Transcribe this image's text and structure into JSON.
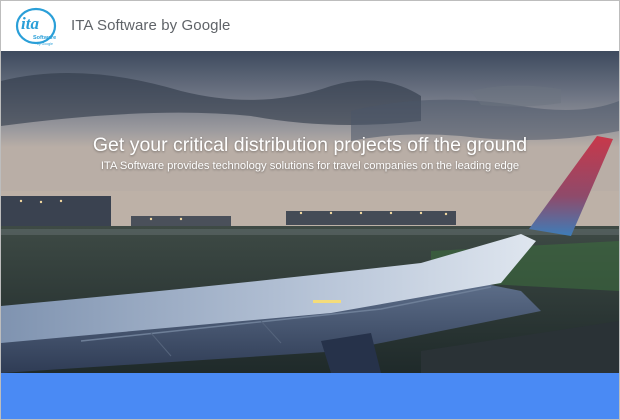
{
  "header": {
    "logo_text": "ita",
    "logo_sub": "Software",
    "logo_small": "by Google",
    "title": "ITA Software by Google"
  },
  "hero": {
    "headline": "Get your critical distribution projects off the ground",
    "subheadline": "ITA Software provides technology solutions for travel companies on the leading edge"
  },
  "colors": {
    "brand_blue": "#4a8af4",
    "header_text": "#5f6368",
    "logo_blue": "#2a9fd8"
  }
}
